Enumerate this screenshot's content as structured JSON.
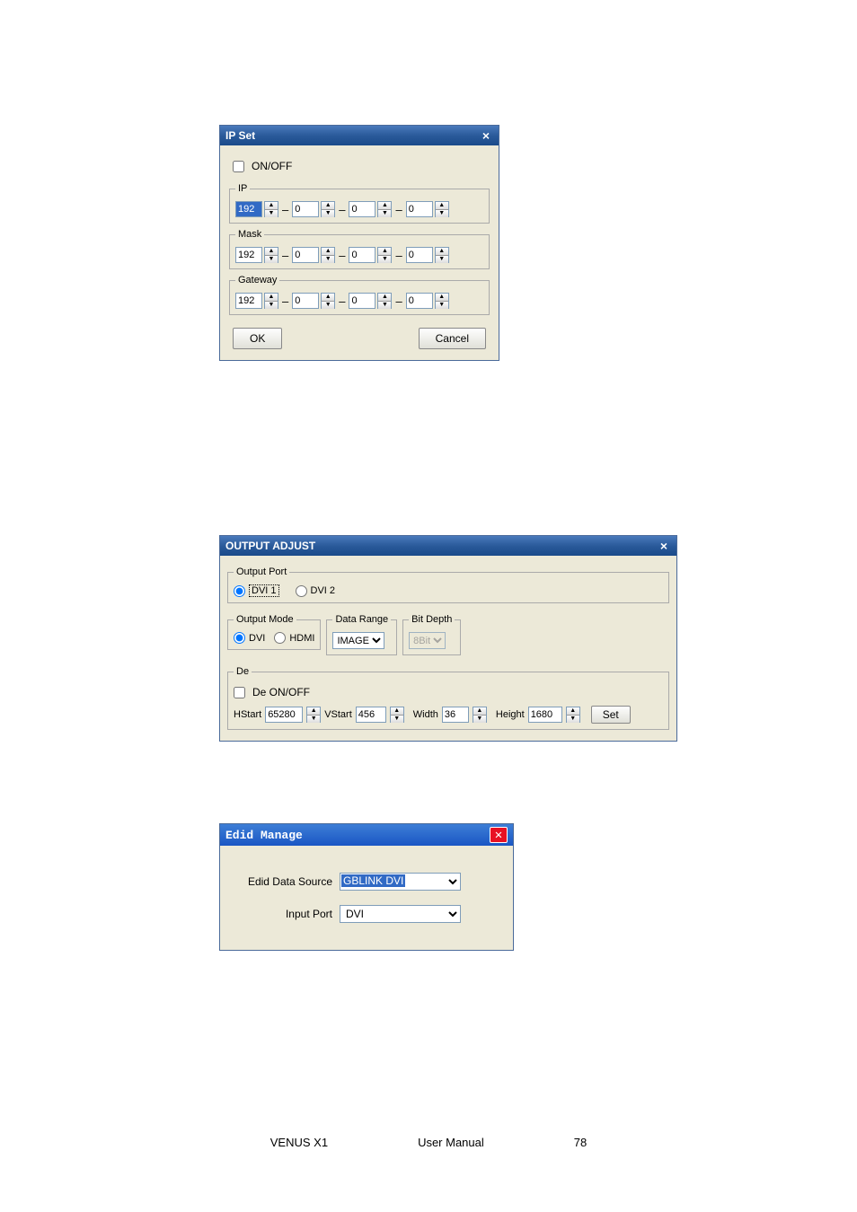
{
  "ipset": {
    "title": "IP Set",
    "onoff_label": "ON/OFF",
    "groups": {
      "ip": {
        "legend": "IP",
        "octets": [
          "192",
          "0",
          "0",
          "0"
        ]
      },
      "mask": {
        "legend": "Mask",
        "octets": [
          "192",
          "0",
          "0",
          "0"
        ]
      },
      "gateway": {
        "legend": "Gateway",
        "octets": [
          "192",
          "0",
          "0",
          "0"
        ]
      }
    },
    "ok": "OK",
    "cancel": "Cancel"
  },
  "output": {
    "title": "OUTPUT ADJUST",
    "port_legend": "Output Port",
    "port_options": {
      "dvi1": "DVI 1",
      "dvi2": "DVI 2"
    },
    "mode_legend": "Output Mode",
    "mode_options": {
      "dvi": "DVI",
      "hdmi": "HDMI"
    },
    "data_range_legend": "Data Range",
    "data_range_value": "IMAGE",
    "bit_depth_legend": "Bit Depth",
    "bit_depth_value": "8Bit",
    "de_legend": "De",
    "de_onoff": "De ON/OFF",
    "hstart_label": "HStart",
    "hstart_value": "65280",
    "vstart_label": "VStart",
    "vstart_value": "456",
    "width_label": "Width",
    "width_value": "36",
    "height_label": "Height",
    "height_value": "1680",
    "set_button": "Set"
  },
  "edid": {
    "title": "Edid Manage",
    "source_label": "Edid Data Source",
    "source_value": "GBLINK DVI",
    "port_label": "Input Port",
    "port_value": "DVI"
  },
  "footer": {
    "product": "VENUS X1",
    "doc": "User Manual",
    "page": "78"
  }
}
